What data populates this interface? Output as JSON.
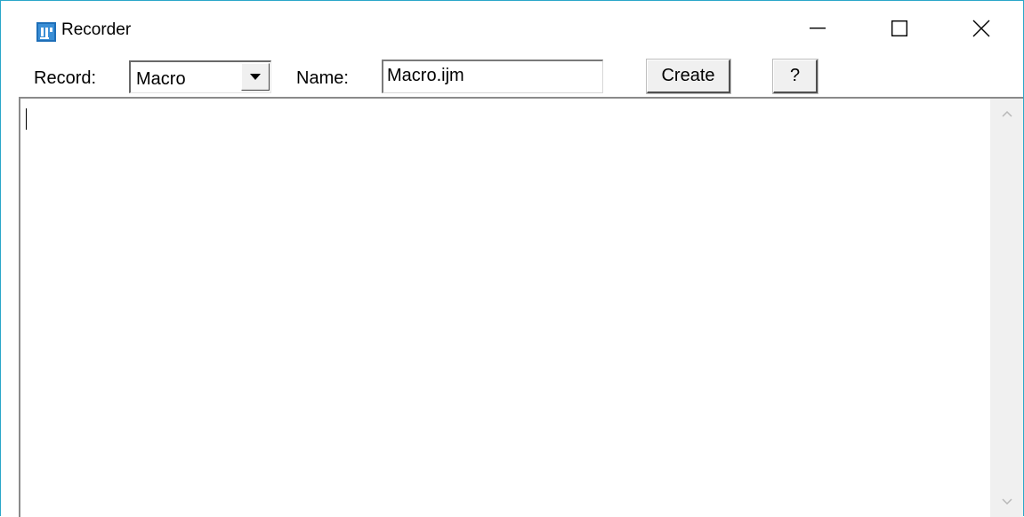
{
  "window": {
    "title": "Recorder",
    "accent_color": "#2aa7c9",
    "app_icon": "imagej-icon",
    "controls": [
      "minimize-icon",
      "maximize-icon",
      "close-icon"
    ]
  },
  "toolbar": {
    "record_label": "Record:",
    "record_value": "Macro",
    "name_label": "Name:",
    "name_value": "Macro.ijm",
    "create_label": "Create",
    "help_label": "?"
  },
  "editor": {
    "content": ""
  }
}
